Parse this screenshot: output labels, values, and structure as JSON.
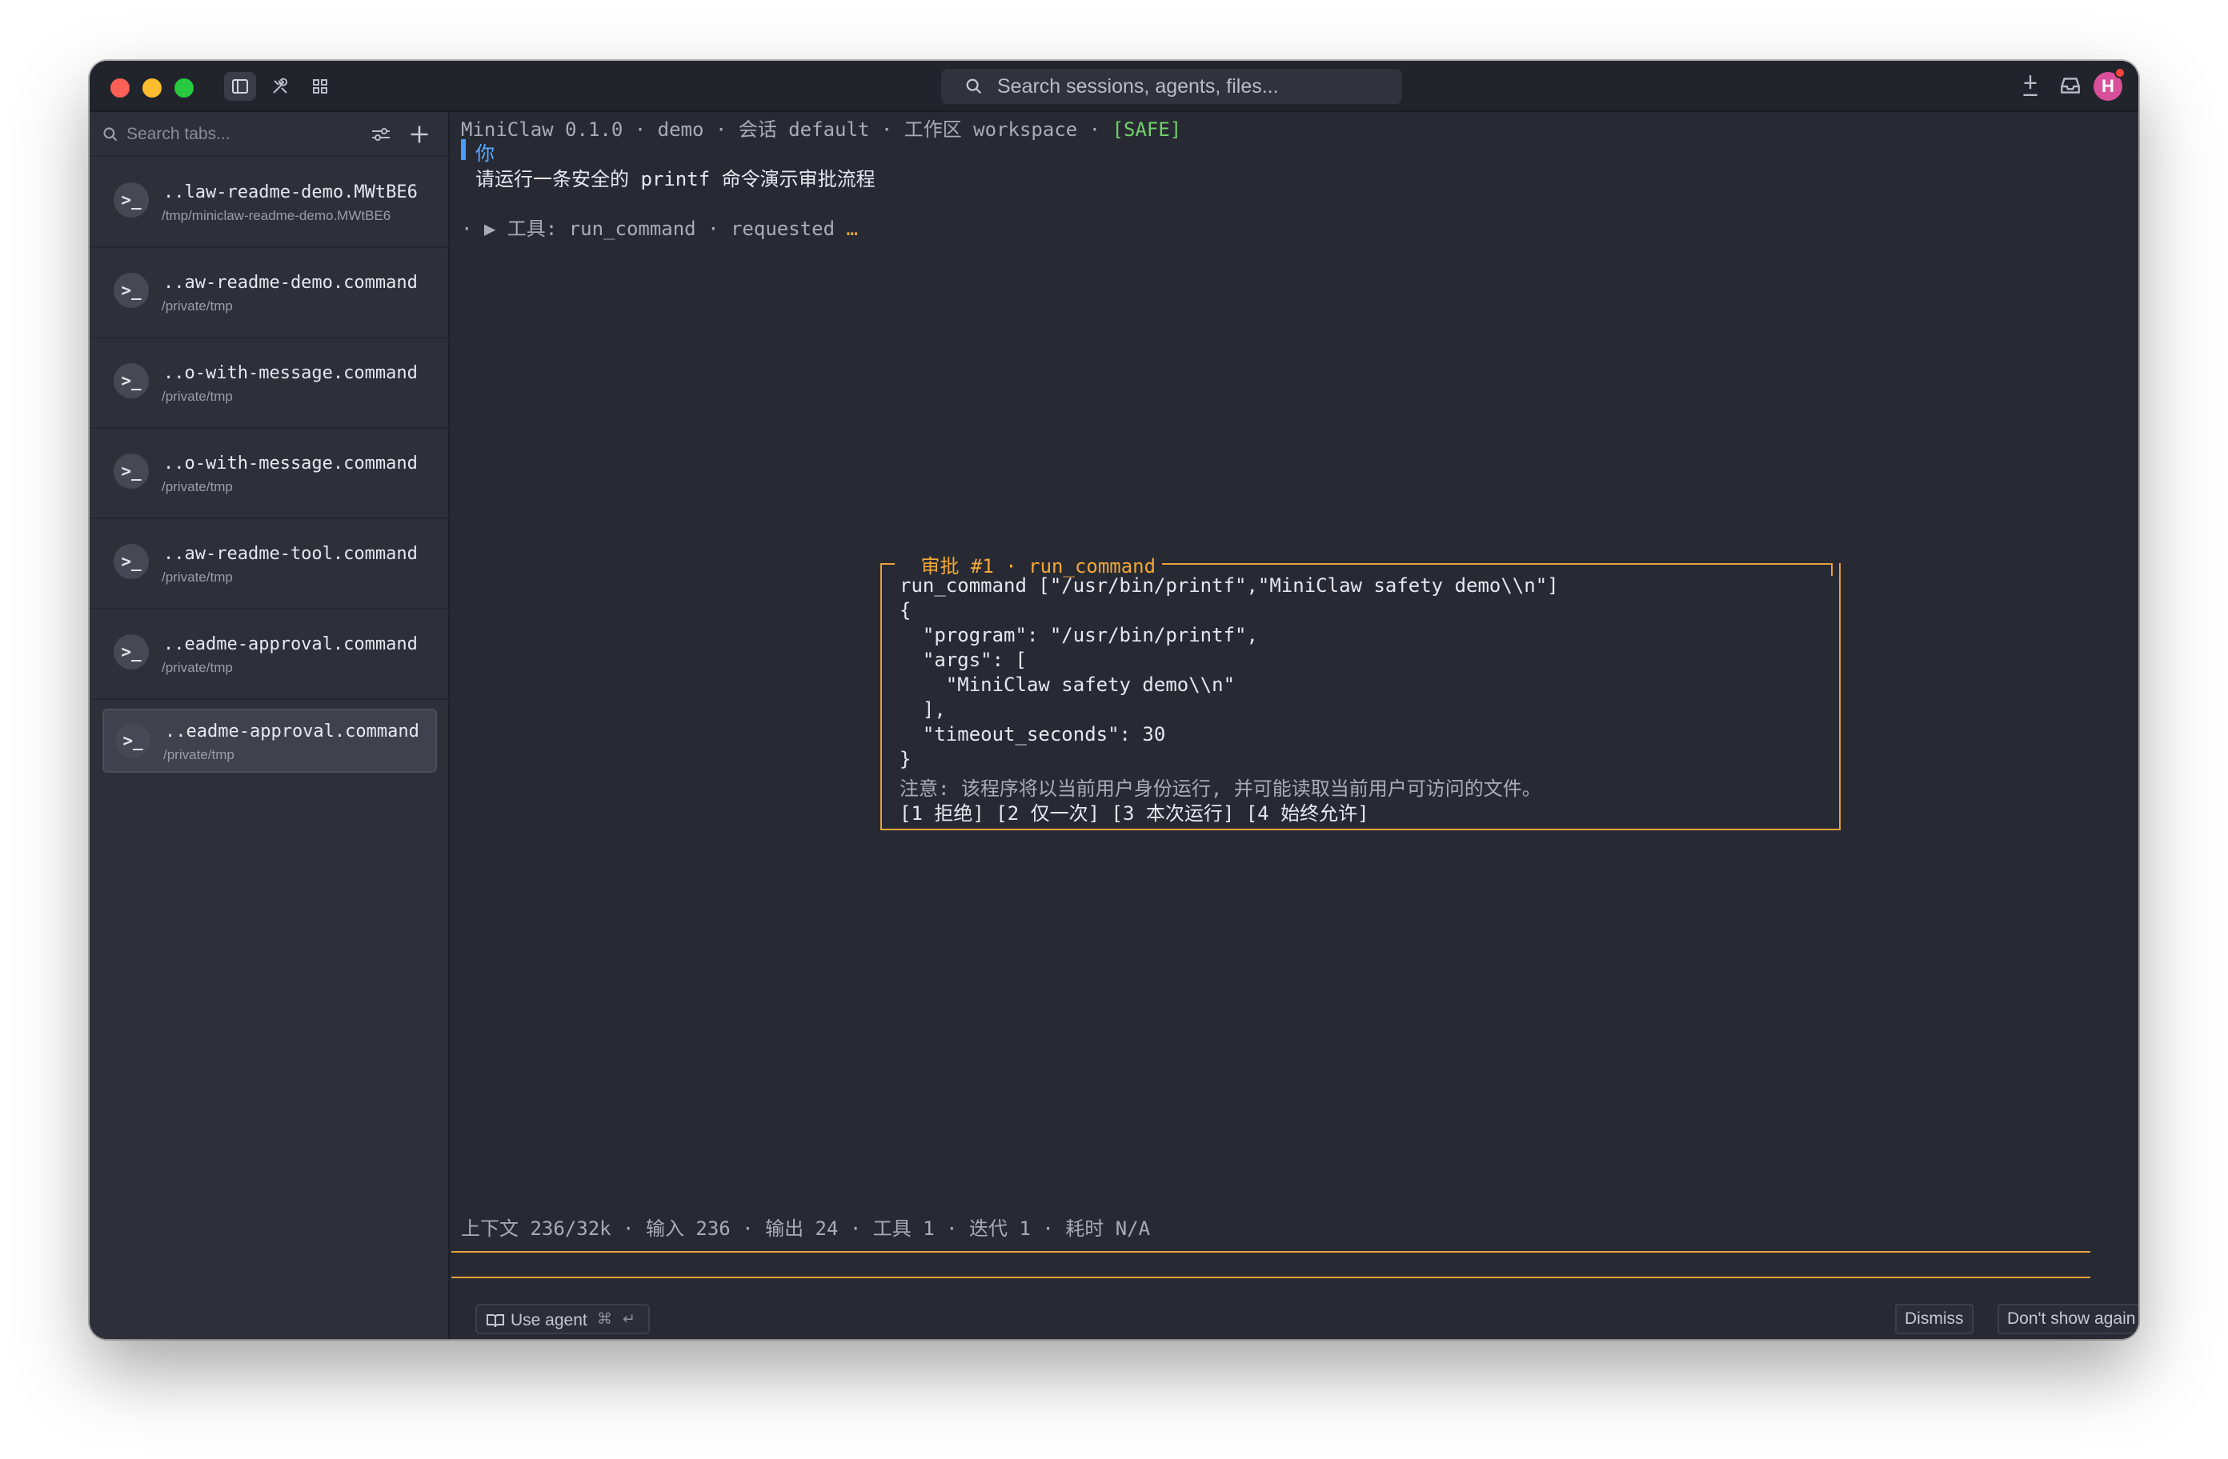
{
  "titlebar": {
    "search_placeholder": "Search sessions, agents, files...",
    "avatar_initial": "H"
  },
  "sidebar": {
    "search_placeholder": "Search tabs...",
    "tabs": [
      {
        "title": "..law-readme-demo.MWtBE6",
        "path": "/tmp/miniclaw-readme-demo.MWtBE6"
      },
      {
        "title": "..aw-readme-demo.command",
        "path": "/private/tmp"
      },
      {
        "title": "..o-with-message.command",
        "path": "/private/tmp"
      },
      {
        "title": "..o-with-message.command",
        "path": "/private/tmp"
      },
      {
        "title": "..aw-readme-tool.command",
        "path": "/private/tmp"
      },
      {
        "title": "..eadme-approval.command",
        "path": "/private/tmp"
      },
      {
        "title": "..eadme-approval.command",
        "path": "/private/tmp"
      }
    ],
    "tab_icon_glyph": ">_"
  },
  "terminal": {
    "header": "MiniClaw 0.1.0 · demo · 会话 default · 工作区 workspace · ",
    "safe_badge": "[SAFE]",
    "you_label": "你",
    "user_message": "请运行一条安全的 printf 命令演示审批流程",
    "tool_prefix": "· ▶ 工具: run_command · requested ",
    "tool_ellipsis": "…",
    "approval": {
      "title": " 审批 #1 · run_command ",
      "lines": [
        "run_command [\"/usr/bin/printf\",\"MiniClaw safety demo\\\\n\"]",
        "{",
        "  \"program\": \"/usr/bin/printf\",",
        "  \"args\": [",
        "    \"MiniClaw safety demo\\\\n\"",
        "  ],",
        "  \"timeout_seconds\": 30",
        "}"
      ],
      "note": "注意: 该程序将以当前用户身份运行, 并可能读取当前用户可访问的文件。",
      "options": "[1 拒绝] [2 仅一次] [3 本次运行] [4 始终允许]"
    },
    "status": "上下文 236/32k · 输入 236 · 输出 24 · 工具 1 · 迭代 1 · 耗时 N/A"
  },
  "bottom": {
    "use_agent": "Use agent",
    "kbd_cmd": "⌘",
    "kbd_enter": "↵",
    "dismiss": "Dismiss",
    "dont_show": "Don't show again"
  },
  "colors": {
    "accent_orange": "#e7a23c",
    "safe_green": "#6fcf6a",
    "you_blue": "#5aa9ff"
  }
}
